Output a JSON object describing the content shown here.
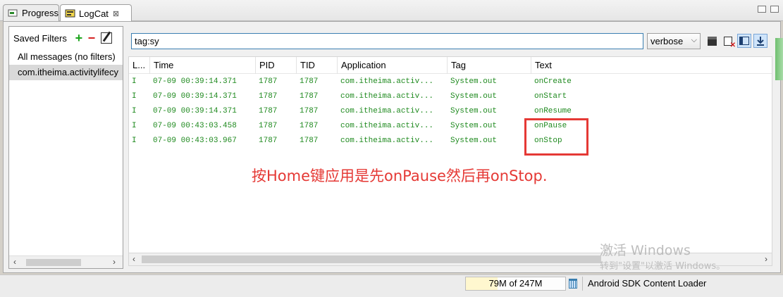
{
  "tabs": [
    {
      "label": "Progress",
      "icon": "progress-icon"
    },
    {
      "label": "LogCat",
      "icon": "logcat-icon",
      "close": "⊠"
    }
  ],
  "filters": {
    "title": "Saved Filters",
    "items": [
      "All messages (no filters)",
      "com.itheima.activitylifecy"
    ]
  },
  "search": {
    "value": "tag:sy"
  },
  "level": {
    "value": "verbose"
  },
  "columns": [
    "L...",
    "Time",
    "PID",
    "TID",
    "Application",
    "Tag",
    "Text"
  ],
  "rows": [
    {
      "level": "I",
      "time": "07-09 00:39:14.371",
      "pid": "1787",
      "tid": "1787",
      "app": "com.itheima.activ...",
      "tag": "System.out",
      "text": "onCreate"
    },
    {
      "level": "I",
      "time": "07-09 00:39:14.371",
      "pid": "1787",
      "tid": "1787",
      "app": "com.itheima.activ...",
      "tag": "System.out",
      "text": "onStart"
    },
    {
      "level": "I",
      "time": "07-09 00:39:14.371",
      "pid": "1787",
      "tid": "1787",
      "app": "com.itheima.activ...",
      "tag": "System.out",
      "text": "onResume"
    },
    {
      "level": "I",
      "time": "07-09 00:43:03.458",
      "pid": "1787",
      "tid": "1787",
      "app": "com.itheima.activ...",
      "tag": "System.out",
      "text": "onPause"
    },
    {
      "level": "I",
      "time": "07-09 00:43:03.967",
      "pid": "1787",
      "tid": "1787",
      "app": "com.itheima.activ...",
      "tag": "System.out",
      "text": "onStop"
    }
  ],
  "annotation": "按Home键应用是先onPause然后再onStop.",
  "watermark": {
    "line1": "激活 Windows",
    "line2": "转到\"设置\"以激活 Windows。"
  },
  "status": {
    "heap": "79M of 247M",
    "loader": "Android SDK Content Loader"
  },
  "colors": {
    "log_info": "#1f8a1f",
    "annotation": "#e53935",
    "accent": "#3c7fb1"
  }
}
